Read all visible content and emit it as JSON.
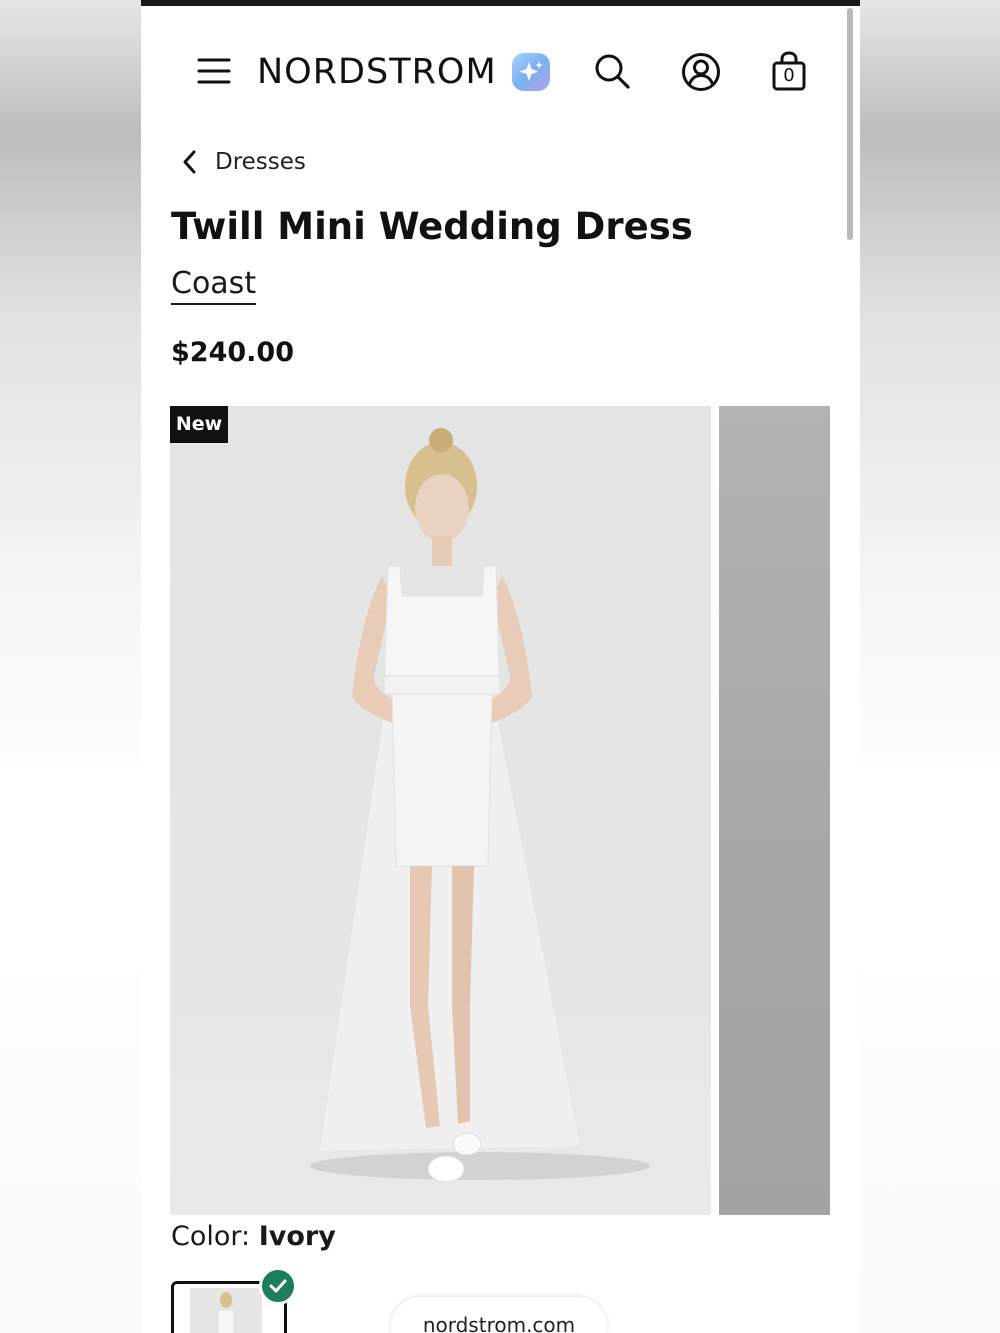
{
  "header": {
    "logo_text": "NORDSTROM",
    "cart_count": "0"
  },
  "breadcrumb": {
    "label": "Dresses"
  },
  "product": {
    "title": "Twill Mini Wedding Dress",
    "brand": "Coast",
    "price": "$240.00",
    "badge": "New",
    "color_label": "Color:",
    "color_value": "Ivory"
  },
  "browser": {
    "url": "nordstrom.com"
  },
  "colors": {
    "text": "#111111",
    "badge_bg": "#111111",
    "check_green": "#1e7d5a",
    "ai_badge_gradient_start": "#a6d2ff",
    "ai_badge_gradient_end": "#b6a2f0"
  },
  "icons": [
    "menu-icon",
    "sparkle-icon",
    "search-icon",
    "account-icon",
    "shopping-bag-icon",
    "chevron-left-icon",
    "checkmark-icon"
  ]
}
